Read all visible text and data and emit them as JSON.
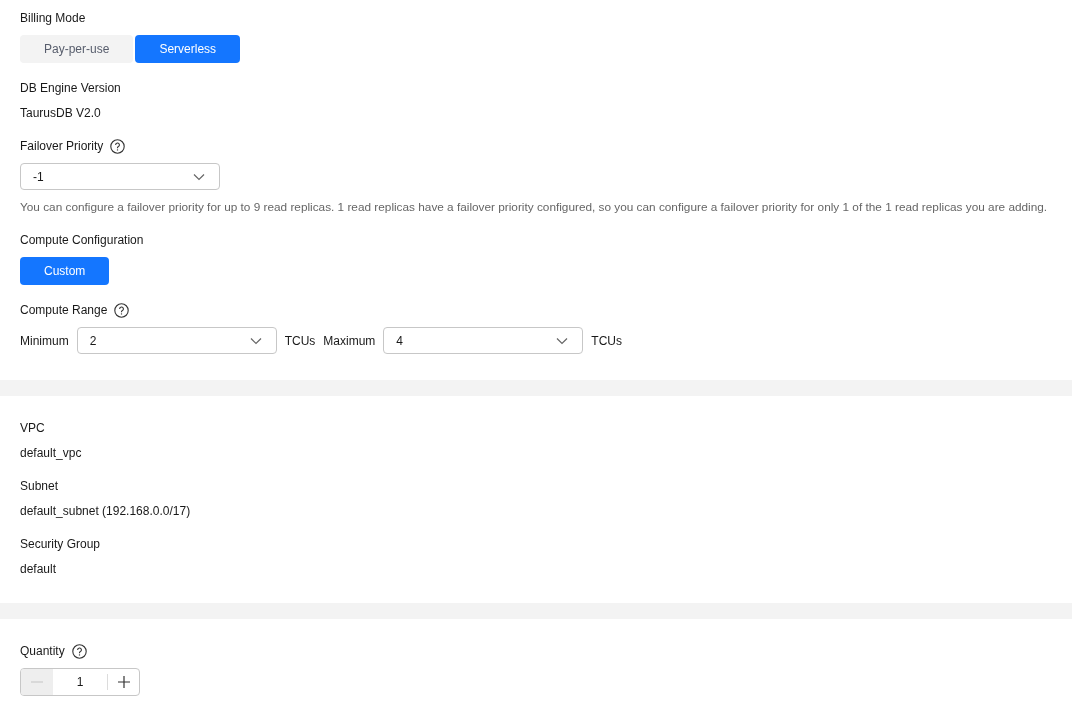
{
  "sections": [
    {
      "fields": [
        {
          "kind": "segmented",
          "label": "Billing Mode",
          "options": [
            {
              "label": "Pay-per-use",
              "selected": false
            },
            {
              "label": "Serverless",
              "selected": true
            }
          ]
        },
        {
          "kind": "text",
          "label": "DB Engine Version",
          "value": "TaurusDB V2.0"
        },
        {
          "kind": "select",
          "label": "Failover Priority",
          "help": true,
          "value": "-1",
          "hint": "You can configure a failover priority for up to 9 read replicas. 1 read replicas have a failover priority configured, so you can configure a failover priority for only 1 of the 1 read replicas you are adding."
        },
        {
          "kind": "segmented",
          "label": "Compute Configuration",
          "options": [
            {
              "label": "Custom",
              "selected": true
            }
          ]
        },
        {
          "kind": "range",
          "label": "Compute Range",
          "help": true,
          "min_label": "Minimum",
          "min_value": "2",
          "min_unit": "TCUs",
          "max_label": "Maximum",
          "max_value": "4",
          "max_unit": "TCUs"
        }
      ]
    },
    {
      "fields": [
        {
          "kind": "text",
          "label": "VPC",
          "value": "default_vpc"
        },
        {
          "kind": "text",
          "label": "Subnet",
          "value": "default_subnet (192.168.0.0/17)"
        },
        {
          "kind": "text",
          "label": "Security Group",
          "value": "default"
        }
      ]
    },
    {
      "fields": [
        {
          "kind": "stepper",
          "label": "Quantity",
          "help": true,
          "value": "1",
          "decrement_disabled": true,
          "increment_disabled": false
        }
      ]
    }
  ]
}
